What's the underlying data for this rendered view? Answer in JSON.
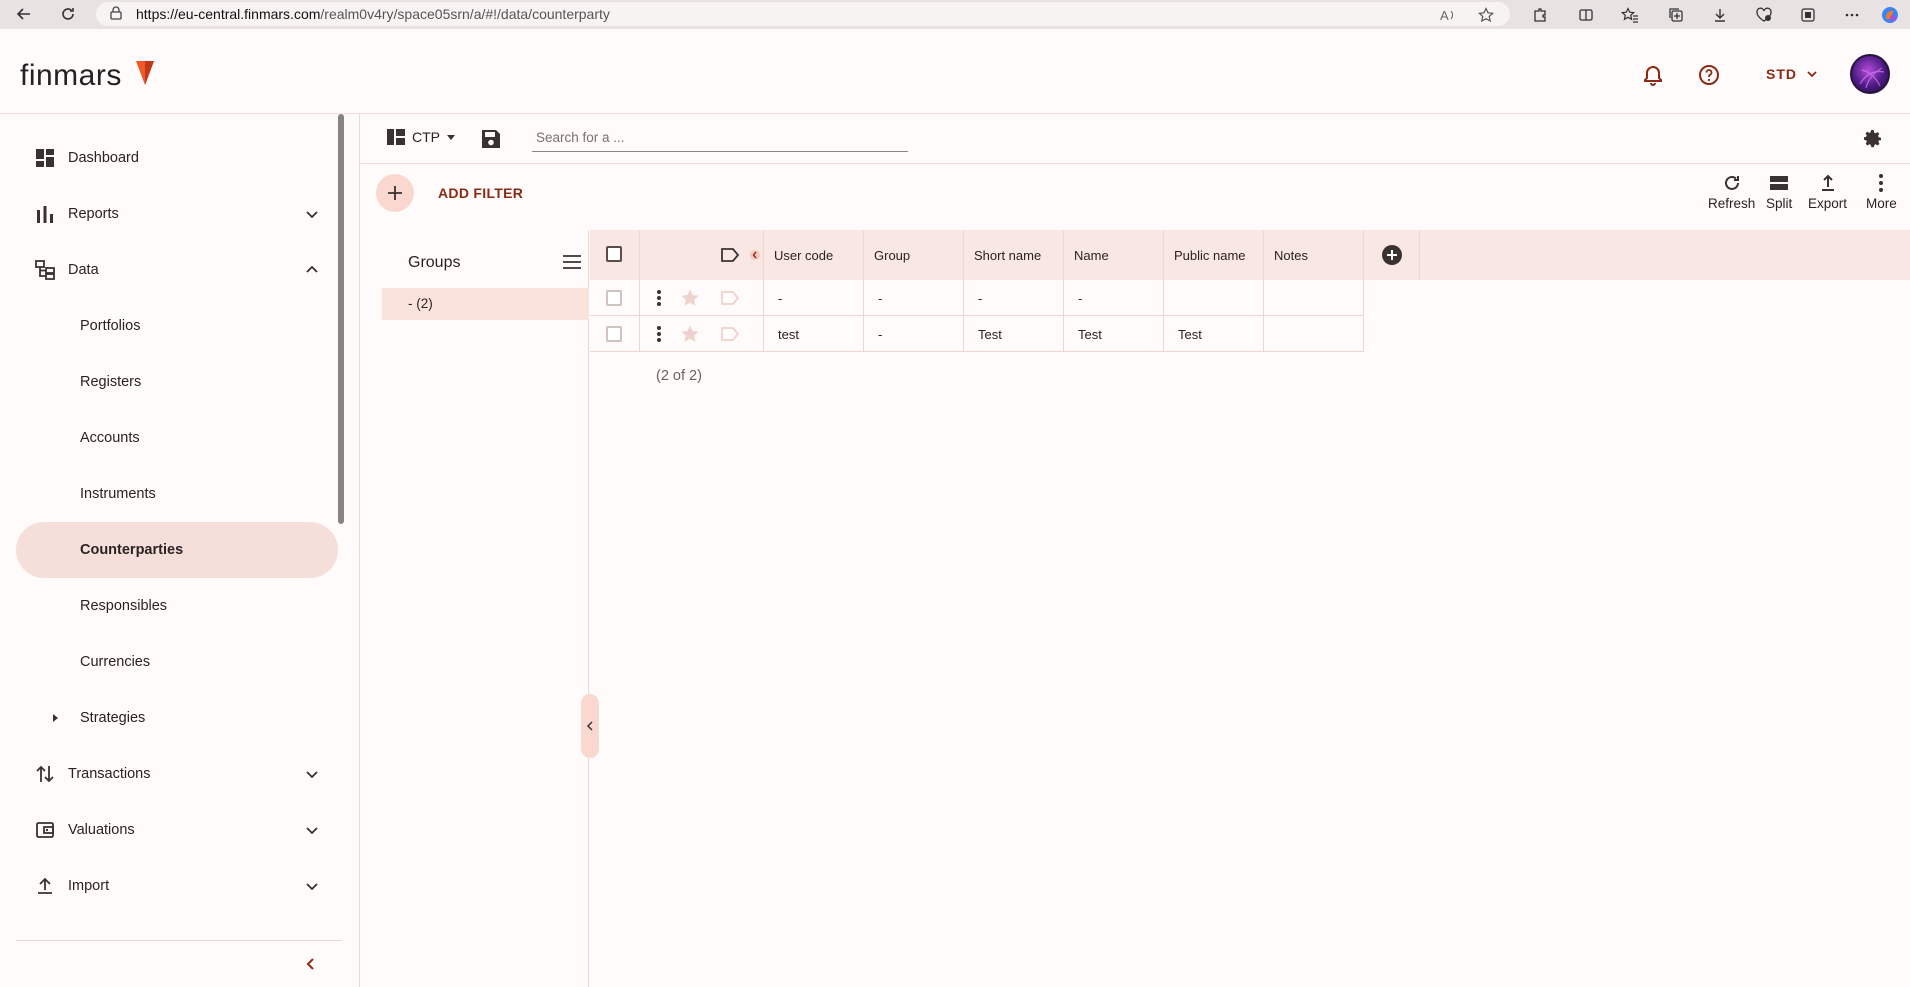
{
  "browser": {
    "url_host": "https://eu-central.finmars.com",
    "url_path": "/realm0v4ry/space05srn/a/#!/data/counterparty"
  },
  "header": {
    "logo": "finmars",
    "standard_label": "STD"
  },
  "sidebar": {
    "items": [
      {
        "label": "Dashboard",
        "icon": "dashboard-icon"
      },
      {
        "label": "Reports",
        "icon": "bar-chart-icon"
      },
      {
        "label": "Data",
        "icon": "data-tree-icon"
      },
      {
        "label": "Portfolios"
      },
      {
        "label": "Registers"
      },
      {
        "label": "Accounts"
      },
      {
        "label": "Instruments"
      },
      {
        "label": "Counterparties"
      },
      {
        "label": "Responsibles"
      },
      {
        "label": "Currencies"
      },
      {
        "label": "Strategies"
      },
      {
        "label": "Transactions",
        "icon": "transactions-icon"
      },
      {
        "label": "Valuations",
        "icon": "wallet-icon"
      },
      {
        "label": "Import",
        "icon": "upload-icon"
      }
    ],
    "active": "Counterparties"
  },
  "toolbar": {
    "layout_name": "CTP",
    "search_placeholder": "Search for a ..."
  },
  "filters": {
    "add_label": "ADD FILTER"
  },
  "actions": {
    "refresh": "Refresh",
    "split": "Split",
    "export": "Export",
    "more": "More"
  },
  "groups": {
    "title": "Groups",
    "row_label": "- (2)"
  },
  "table": {
    "columns": [
      "User code",
      "Group",
      "Short name",
      "Name",
      "Public name",
      "Notes"
    ],
    "rows": [
      {
        "user_code": "-",
        "group": "-",
        "short_name": "-",
        "name": "-",
        "public_name": "",
        "notes": ""
      },
      {
        "user_code": "test",
        "group": "-",
        "short_name": "Test",
        "name": "Test",
        "public_name": "Test",
        "notes": ""
      }
    ],
    "count_text": "(2 of 2)"
  },
  "colors": {
    "accent": "#8a2a14",
    "active_bg": "#f4dfdb",
    "header_bg": "#f8e7e3"
  }
}
